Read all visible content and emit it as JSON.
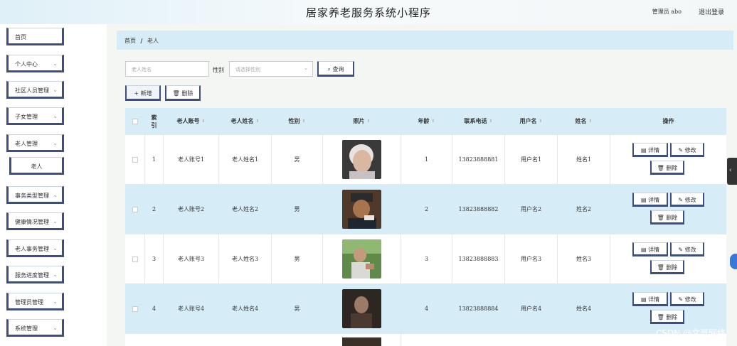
{
  "header": {
    "title": "居家养老服务系统小程序",
    "user_label": "管理员 abo",
    "logout": "退出登录"
  },
  "sidebar": {
    "items": [
      {
        "label": "首页",
        "chevron": false
      },
      {
        "label": "个人中心",
        "chevron": true
      },
      {
        "label": "社区人员管理",
        "chevron": true
      },
      {
        "label": "子女管理",
        "chevron": true
      },
      {
        "label": "老人管理",
        "chevron": true
      },
      {
        "label": "老人",
        "chevron": false,
        "sub": true
      },
      {
        "label": "事务类型管理",
        "chevron": true
      },
      {
        "label": "健康情况管理",
        "chevron": true
      },
      {
        "label": "老人事务管理",
        "chevron": true
      },
      {
        "label": "服务进度管理",
        "chevron": true
      },
      {
        "label": "管理员管理",
        "chevron": true
      },
      {
        "label": "系统管理",
        "chevron": true
      }
    ]
  },
  "breadcrumb": {
    "home": "首页",
    "sep": "/",
    "current": "老人"
  },
  "search": {
    "name_placeholder": "老人姓名",
    "gender_label": "性别",
    "gender_placeholder": "请选择性别",
    "query_button": "查询"
  },
  "toolbar": {
    "add": "+ 新增",
    "delete": "删除"
  },
  "table": {
    "columns": [
      "索引",
      "老人账号",
      "老人姓名",
      "性别",
      "照片",
      "年龄",
      "联系电话",
      "用户名",
      "姓名",
      "操作"
    ],
    "rows": [
      {
        "index": "1",
        "account": "老人账号1",
        "name": "老人姓名1",
        "gender": "男",
        "age": "1",
        "phone": "13823888881",
        "username": "用户名1",
        "realname": "姓名1"
      },
      {
        "index": "2",
        "account": "老人账号2",
        "name": "老人姓名2",
        "gender": "男",
        "age": "2",
        "phone": "13823888882",
        "username": "用户名2",
        "realname": "姓名2"
      },
      {
        "index": "3",
        "account": "老人账号3",
        "name": "老人姓名3",
        "gender": "男",
        "age": "3",
        "phone": "13823888883",
        "username": "用户名3",
        "realname": "姓名3"
      },
      {
        "index": "4",
        "account": "老人账号4",
        "name": "老人姓名4",
        "gender": "男",
        "age": "4",
        "phone": "13823888884",
        "username": "用户名4",
        "realname": "姓名4"
      }
    ],
    "actions": {
      "detail": "详情",
      "edit": "修改",
      "delete": "删除"
    }
  },
  "watermark": "CSDN @文哥网络",
  "colors": {
    "accent": "#3f4f7b",
    "header_bg": "#d6edf8"
  }
}
